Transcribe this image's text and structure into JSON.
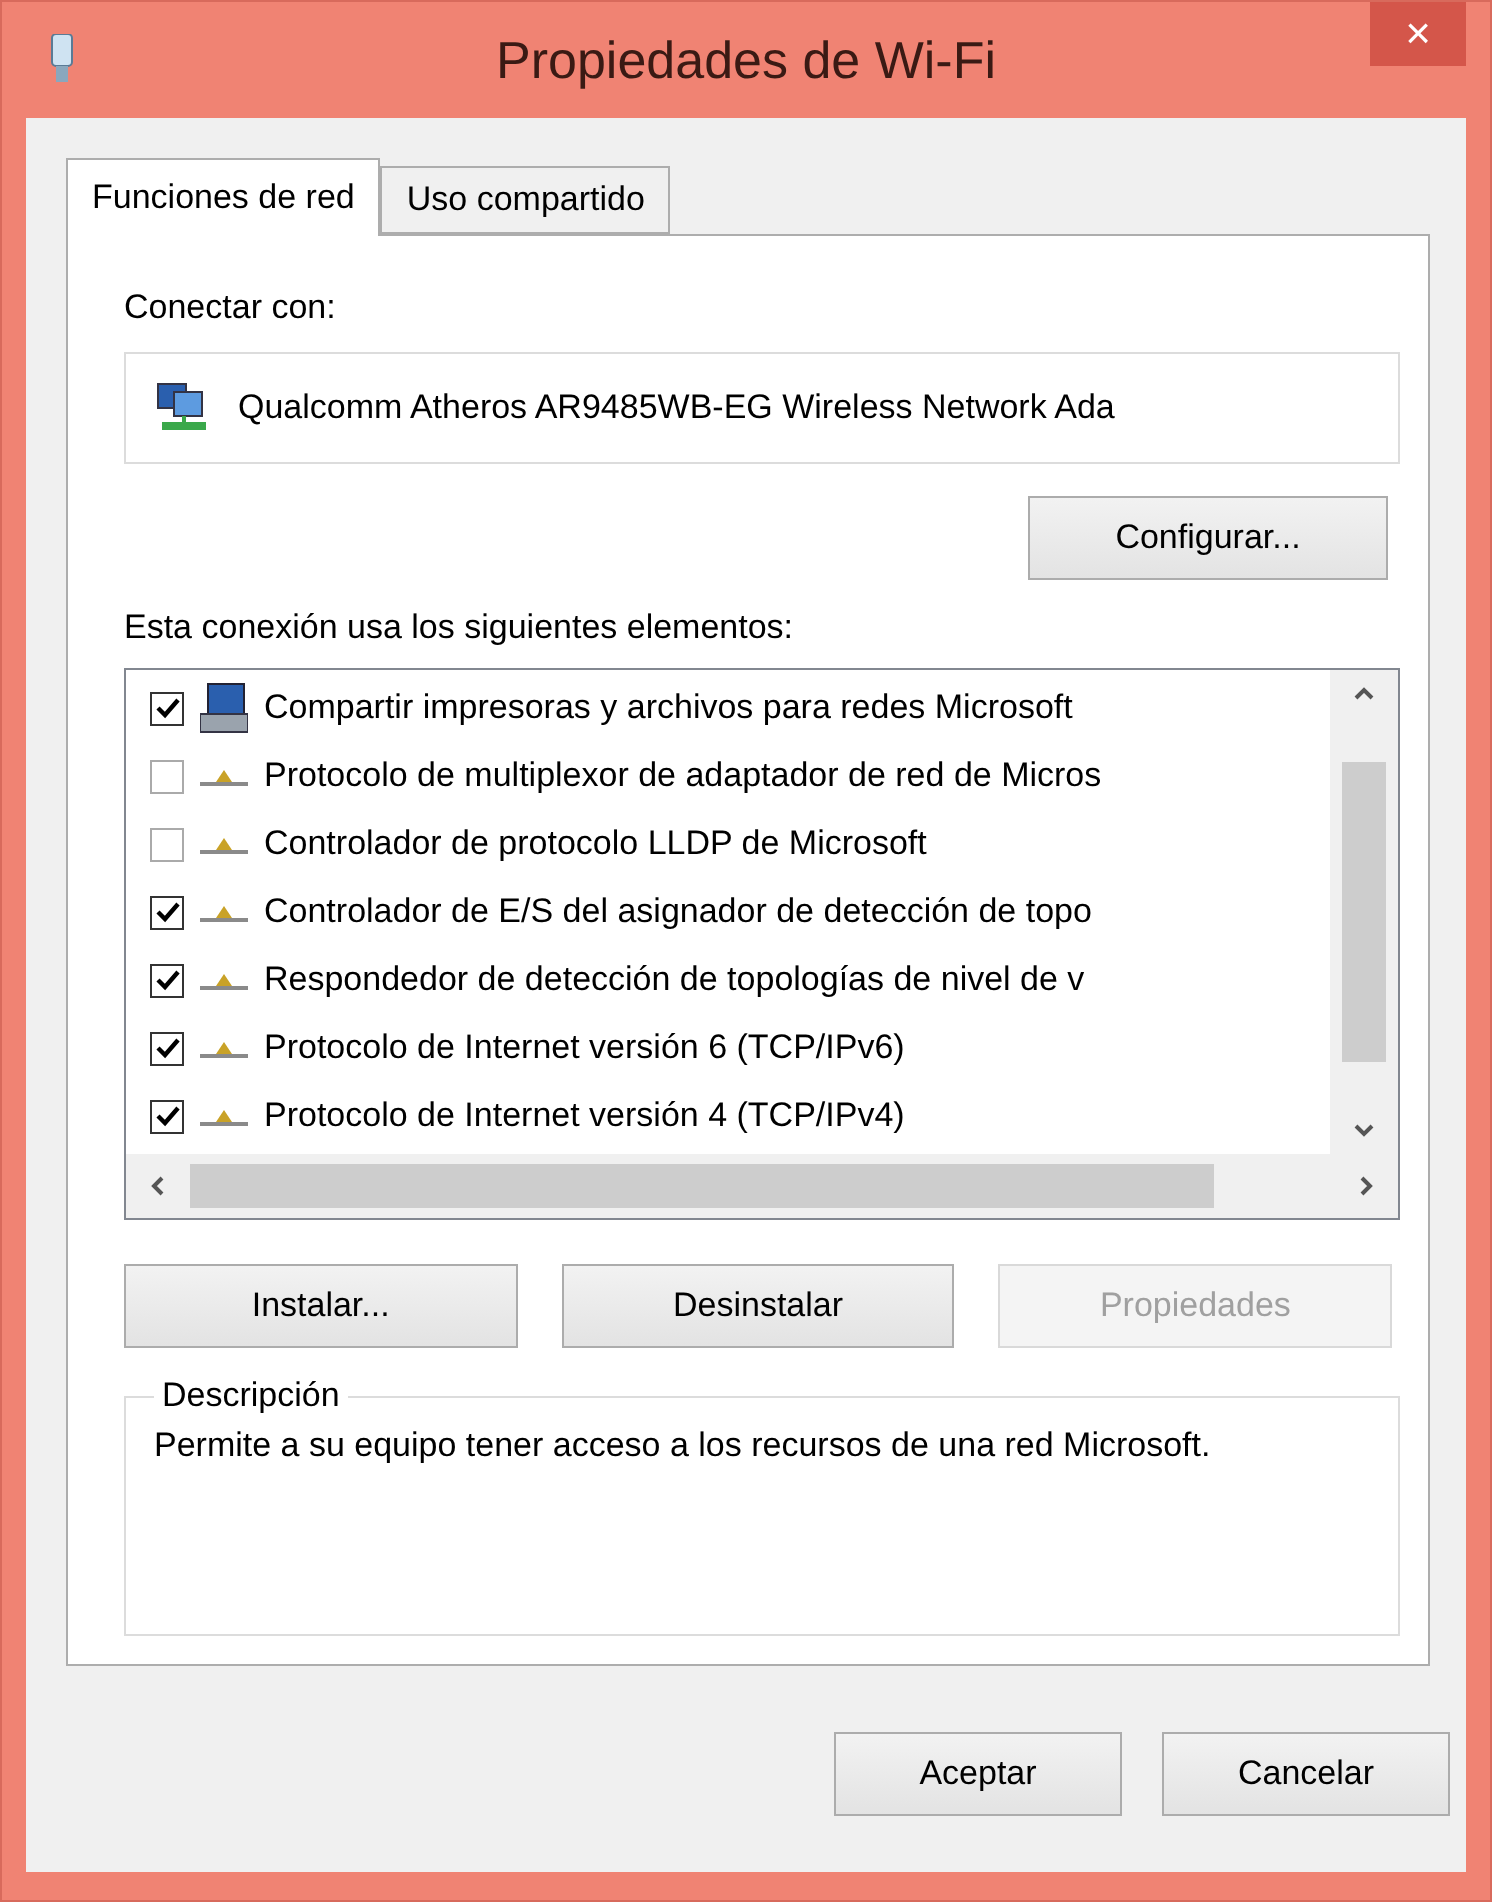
{
  "window": {
    "title": "Propiedades de Wi-Fi",
    "close": "×"
  },
  "tabs": [
    {
      "label": "Funciones de red",
      "selected": true
    },
    {
      "label": "Uso compartido",
      "selected": false
    }
  ],
  "connect_label": "Conectar con:",
  "adapter": "Qualcomm Atheros AR9485WB-EG Wireless Network Ada",
  "configure_button": "Configurar...",
  "items_label": "Esta conexión usa los siguientes elementos:",
  "items": [
    {
      "kind": "share",
      "label": "Compartir impresoras y archivos para redes Microsoft",
      "checked": true
    },
    {
      "kind": "protocol",
      "label": "Protocolo de multiplexor de adaptador de red de Micros",
      "checked": false
    },
    {
      "kind": "protocol",
      "label": "Controlador de protocolo LLDP de Microsoft",
      "checked": false
    },
    {
      "kind": "protocol",
      "label": "Controlador de E/S del asignador de detección de topo",
      "checked": true
    },
    {
      "kind": "protocol",
      "label": "Respondedor de detección de topologías de nivel de v",
      "checked": true
    },
    {
      "kind": "protocol",
      "label": "Protocolo de Internet versión 6 (TCP/IPv6)",
      "checked": true
    },
    {
      "kind": "protocol",
      "label": "Protocolo de Internet versión 4 (TCP/IPv4)",
      "checked": true
    }
  ],
  "item_buttons": [
    {
      "label": "Instalar...",
      "disabled": false
    },
    {
      "label": "Desinstalar",
      "disabled": false
    },
    {
      "label": "Propiedades",
      "disabled": true
    }
  ],
  "description": {
    "title": "Descripción",
    "text": "Permite a su equipo tener acceso a los recursos de una red Microsoft."
  },
  "buttons": [
    {
      "label": "Aceptar"
    },
    {
      "label": "Cancelar"
    }
  ]
}
